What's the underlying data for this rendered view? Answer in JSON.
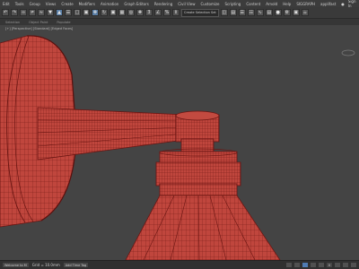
{
  "menu": {
    "items": [
      "Edit",
      "Tools",
      "Group",
      "Views",
      "Create",
      "Modifiers",
      "Animation",
      "Graph Editors",
      "Rendering",
      "Civil View",
      "Customize",
      "Scripting",
      "Content",
      "Arnold",
      "Help",
      "SIGGRAPH",
      "applifast"
    ],
    "sign_in": "Sign In"
  },
  "toolbar": {
    "selection_set": "Create Selection Set"
  },
  "tabs": [
    "Selection",
    "Object Paint",
    "Populate"
  ],
  "viewport": {
    "label": "[+] [Perspective] [Standard] [Edged Faces]",
    "colors": {
      "model": "#c0463d",
      "wire": "#6a1512",
      "background": "#444444"
    }
  },
  "status": {
    "left": "Welcome to M",
    "coord_readout": "Grid = 10.0mm",
    "add_time_tag": "Add Time Tag",
    "frame": "0"
  }
}
